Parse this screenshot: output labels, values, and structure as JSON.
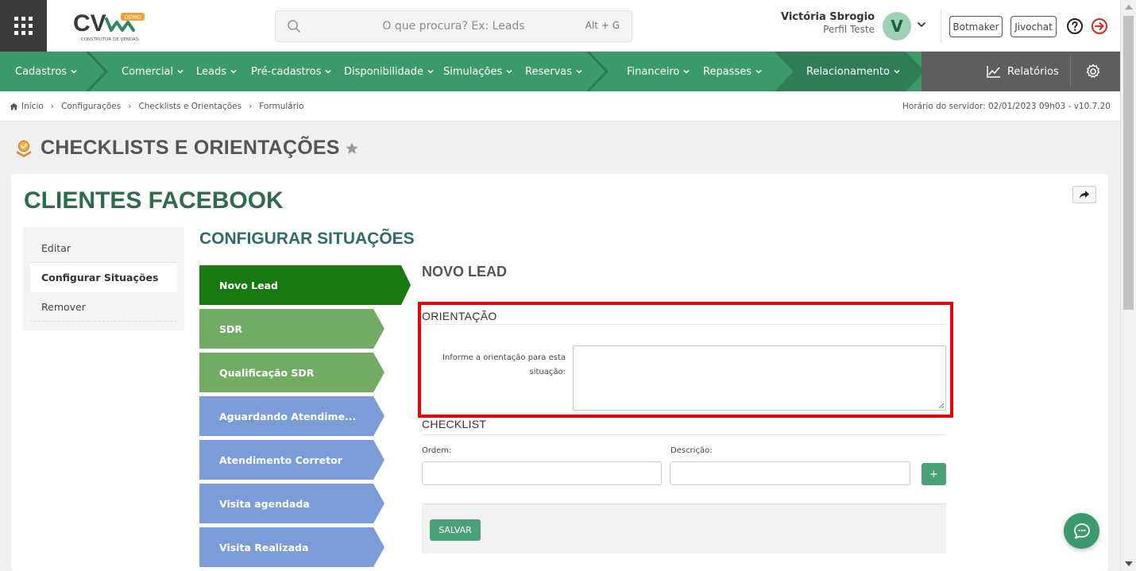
{
  "header": {
    "logo_text": "CV",
    "logo_badge": "DEMO",
    "logo_subtitle": "CONSTRUTOR DE VENDAS",
    "search_placeholder": "O que procura? Ex: Leads",
    "search_shortcut": "Alt + G",
    "user_name": "Victória Sbrogio",
    "user_profile": "Perfil Teste",
    "avatar_initial": "V",
    "botmaker_label": "Botmaker",
    "jivochat_label": "Jivochat",
    "icons": [
      "apps-grid-icon",
      "search-icon",
      "chevron-down-icon",
      "help-icon",
      "logout-icon"
    ]
  },
  "nav": {
    "items": [
      {
        "label": "Cadastros"
      },
      {
        "label": "Comercial"
      },
      {
        "label": "Leads"
      },
      {
        "label": "Pré-cadastros"
      },
      {
        "label": "Disponibilidade"
      },
      {
        "label": "Simulações"
      },
      {
        "label": "Reservas"
      },
      {
        "label": "Financeiro"
      },
      {
        "label": "Repasses"
      },
      {
        "label": "Relacionamento"
      }
    ],
    "reports_label": "Relatórios",
    "colors": {
      "primary": "#3c9a68",
      "dark": "#2d7d54",
      "gray": "#5e5e5e"
    }
  },
  "breadcrumb": {
    "items": [
      "Início",
      "Configurações",
      "Checklists e Orientações",
      "Formulário"
    ],
    "server_time": "Horário do servidor: 02/01/2023 09h03 - v10.7.20"
  },
  "page": {
    "title": "CHECKLISTS E ORIENTAÇÕES"
  },
  "card": {
    "title": "CLIENTES FACEBOOK",
    "menu": [
      "Editar",
      "Configurar Situações",
      "Remover"
    ],
    "section_title": "CONFIGURAR SITUAÇÕES",
    "steps": [
      {
        "label": "Novo Lead",
        "color": "#167a10"
      },
      {
        "label": "SDR",
        "color": "#72ab64"
      },
      {
        "label": "Qualificação SDR",
        "color": "#72ab64"
      },
      {
        "label": "Aguardando Atendime...",
        "color": "#7b9bd9"
      },
      {
        "label": "Atendimento Corretor",
        "color": "#7b9bd9"
      },
      {
        "label": "Visita agendada",
        "color": "#7b9bd9"
      },
      {
        "label": "Visita Realizada",
        "color": "#7b9bd9"
      }
    ],
    "detail": {
      "title": "NOVO LEAD",
      "orientation_heading": "ORIENTAÇÃO",
      "orientation_field_label": "Informe a orientação para esta situação:",
      "orientation_value": "",
      "checklist_heading": "CHECKLIST",
      "order_label": "Ordem:",
      "order_value": "",
      "description_label": "Descrição:",
      "description_value": "",
      "add_label": "+",
      "save_label": "SALVAR",
      "highlight_color": "#e8000b"
    }
  }
}
